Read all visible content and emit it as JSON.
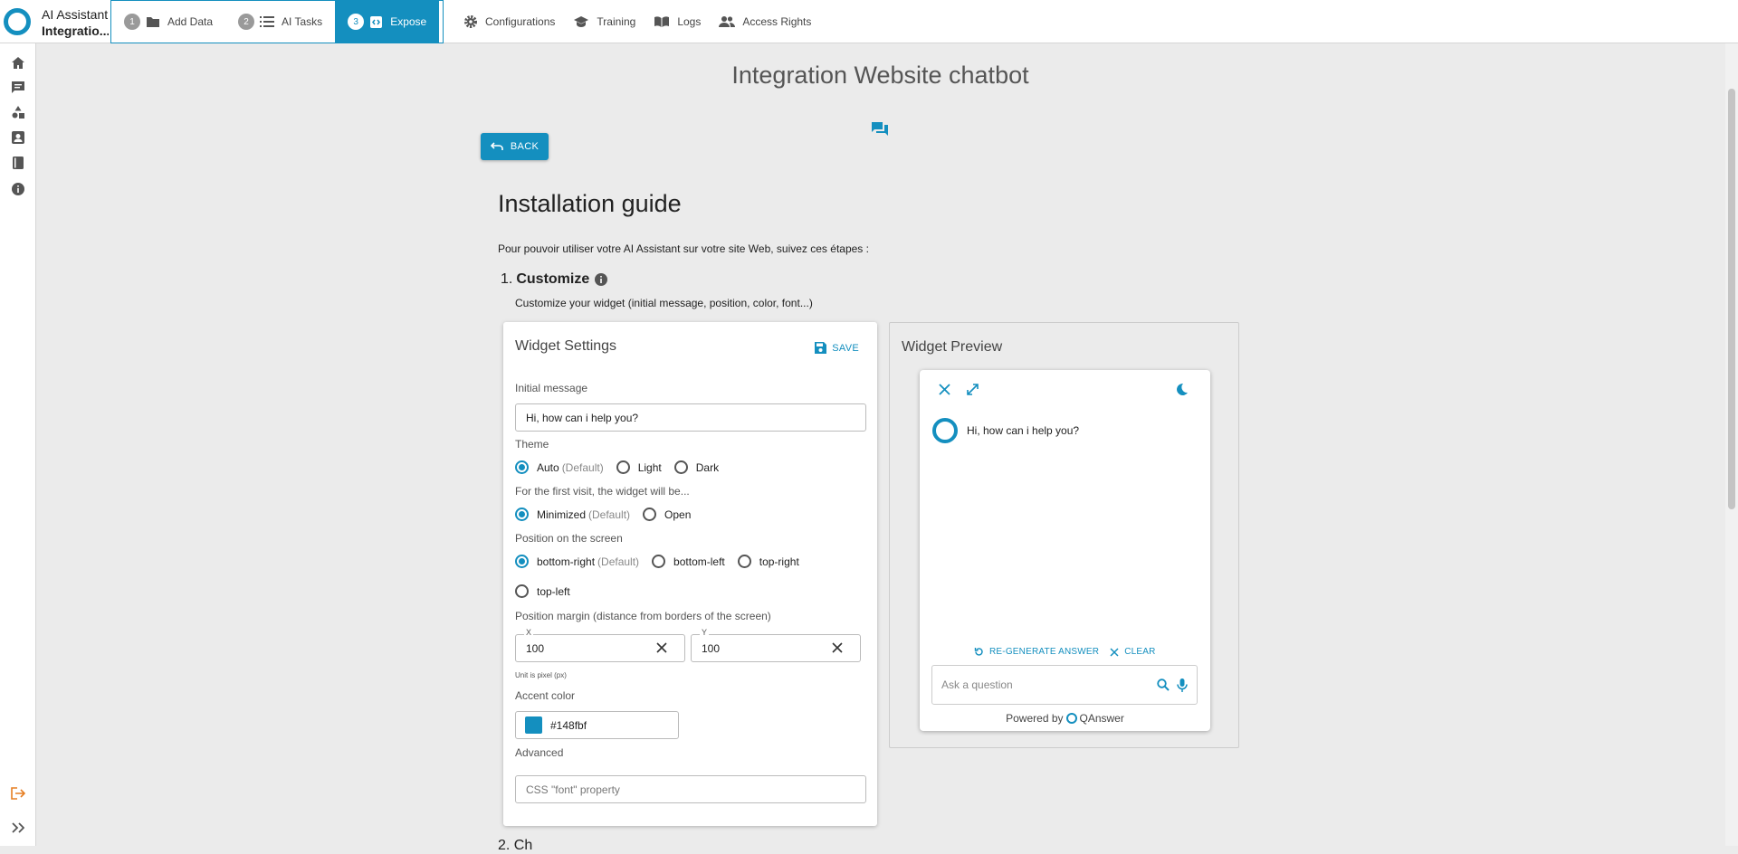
{
  "app": {
    "name": "AI Assistant",
    "project": "Integratio..."
  },
  "steps": [
    {
      "num": "1",
      "label": "Add Data",
      "icon": "folder-icon"
    },
    {
      "num": "2",
      "label": "AI Tasks",
      "icon": "list-icon"
    },
    {
      "num": "3",
      "label": "Expose",
      "icon": "code-icon"
    }
  ],
  "nav": [
    "Configurations",
    "Training",
    "Logs",
    "Access Rights"
  ],
  "page": {
    "title": "Integration Website chatbot",
    "back_label": "BACK",
    "guide_title": "Installation guide",
    "intro": "Pour pouvoir utiliser votre AI Assistant sur votre site Web, suivez ces étapes :",
    "step1_num": "1.",
    "step1_title": "Customize",
    "step1_desc": "Customize your widget (initial message, position, color, font...)",
    "next_section": "2. Ch"
  },
  "settings": {
    "title": "Widget Settings",
    "save_label": "SAVE",
    "initial_label": "Initial message",
    "initial_value": "Hi, how can i help you?",
    "theme_label": "Theme",
    "theme_options": [
      "Auto",
      "Light",
      "Dark"
    ],
    "default_text": "(Default)",
    "first_visit_label": "For the first visit, the widget will be...",
    "first_visit_options": [
      "Minimized",
      "Open"
    ],
    "position_label": "Position on the screen",
    "position_options": [
      "bottom-right",
      "bottom-left",
      "top-right",
      "top-left"
    ],
    "margin_label": "Position margin (distance from borders of the screen)",
    "x_label": "X",
    "x_value": "100",
    "y_label": "Y",
    "y_value": "100",
    "unit_note": "Unit is pixel (px)",
    "accent_label": "Accent color",
    "accent_value": "#148fbf",
    "advanced_label": "Advanced",
    "font_placeholder": "CSS \"font\" property"
  },
  "preview": {
    "title": "Widget Preview",
    "bot_message": "Hi, how can i help you?",
    "regenerate": "RE-GENERATE ANSWER",
    "clear": "CLEAR",
    "ask_placeholder": "Ask a question",
    "powered_by": "Powered by",
    "brand": "QAnswer"
  },
  "colors": {
    "accent": "#148fbf",
    "background": "#ebebeb",
    "logout": "#e67e22"
  }
}
